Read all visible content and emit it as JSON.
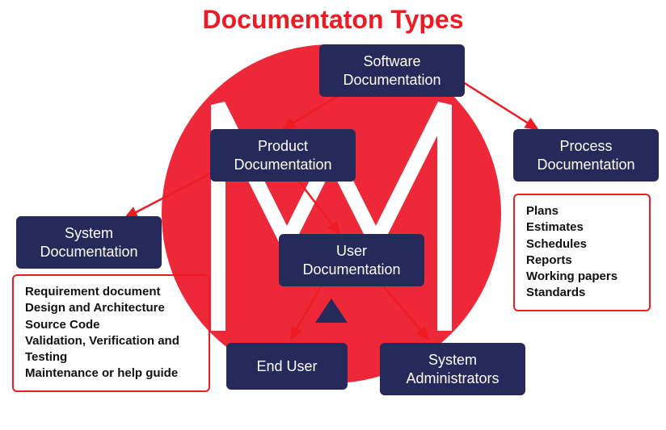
{
  "title": "Documentaton Types",
  "nodes": {
    "software": "Software\nDocumentation",
    "product": "Product\nDocumentation",
    "process": "Process\nDocumentation",
    "system": "System\nDocumentation",
    "user": "User\nDocumentation",
    "enduser": "End User",
    "sysadmin": "System\nAdministrators"
  },
  "system_details": [
    "Requirement document",
    "Design and Architecture",
    "Source Code",
    "Validation, Verification and Testing",
    "Maintenance or help guide"
  ],
  "process_details": [
    "Plans",
    "Estimates",
    "Schedules",
    "Reports",
    "Working papers",
    "Standards"
  ],
  "colors": {
    "accent_red": "#ed1c24",
    "node_bg": "#262a5a",
    "circle": "#ed2939"
  }
}
